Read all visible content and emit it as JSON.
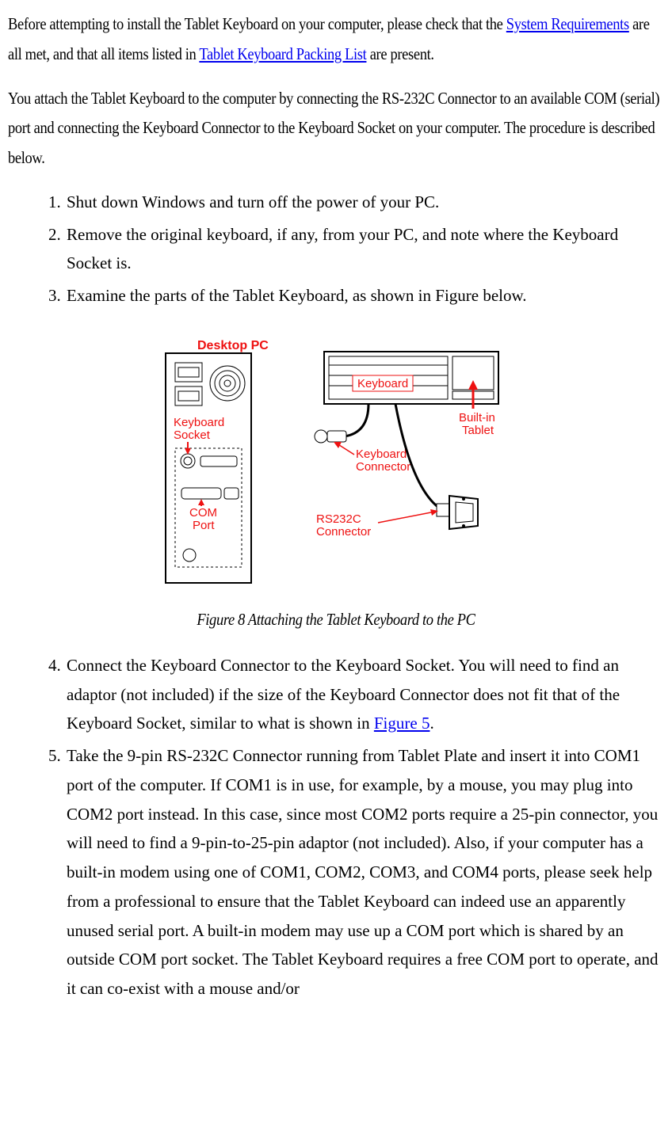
{
  "para1": {
    "t1": "Before attempting to install the Tablet Keyboard on your computer, please check that the ",
    "link1": "System Requirements",
    "t2": " are all met, and that all items listed in ",
    "link2": "Tablet Keyboard Packing List",
    "t3": " are present."
  },
  "para2": "You attach the Tablet Keyboard to the computer by connecting the RS-232C Connector to an available COM (serial) port and connecting the Keyboard Connector to the Keyboard Socket on your computer.   The procedure is described below.",
  "steps": {
    "s1": "Shut down Windows and turn off the power of your PC.",
    "s2": "Remove the original keyboard, if any, from your PC, and note where the Keyboard Socket is.",
    "s3": "Examine the parts of the Tablet Keyboard, as shown in Figure below.",
    "s4a": "Connect the Keyboard Connector to the Keyboard Socket.   You will need to find an adaptor (not included) if the size of the Keyboard Connector does not fit that of the Keyboard Socket, similar to what is shown in ",
    "s4link": "Figure 5",
    "s4b": ".",
    "s5": "Take the 9-pin RS-232C Connector running from Tablet Plate and insert it into COM1 port of the computer.   If COM1 is in use, for example, by a mouse, you may plug into COM2 port instead.   In this case, since most COM2 ports require a 25-pin connector, you will need to find a 9-pin-to-25-pin adaptor (not included). Also, if your computer has a built-in modem using one of COM1, COM2, COM3, and COM4 ports, please seek help from a professional to ensure that the Tablet Keyboard can indeed use an apparently unused serial port. A built-in modem may use up a COM port which is shared by an outside COM port socket. The Tablet Keyboard requires a free COM port to operate, and it can co-exist with a mouse and/or"
  },
  "figure": {
    "caption": "Figure 8 Attaching the Tablet Keyboard to the PC",
    "labels": {
      "desktop": "Desktop PC",
      "keyboard": "Keyboard",
      "keyboard_socket1": "Keyboard",
      "keyboard_socket2": "Socket",
      "builtin1": "Built-in",
      "builtin2": "Tablet",
      "keyboard_conn1": "Keyboard",
      "keyboard_conn2": "Connector",
      "com1": "COM",
      "com2": "Port",
      "rs1": "RS232C",
      "rs2": "Connector"
    }
  }
}
